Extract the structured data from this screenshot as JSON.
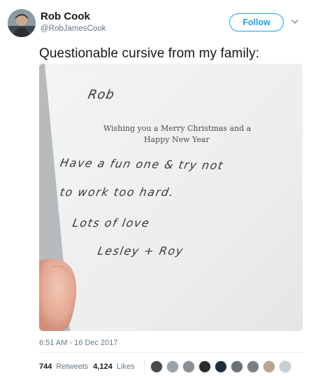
{
  "user": {
    "display_name": "Rob Cook",
    "handle": "@RobJamesCook",
    "follow_label": "Follow"
  },
  "tweet": {
    "text": "Questionable cursive from my family:",
    "timestamp": "6:51 AM - 16 Dec 2017"
  },
  "card": {
    "handwritten_name": "Rob",
    "printed_line1": "Wishing you a Merry Christmas and a",
    "printed_line2": "Happy New Year",
    "handwritten_line1": "Have a fun one & try not",
    "handwritten_line2": "to work too hard.",
    "handwritten_line3": "Lots of love",
    "handwritten_line4": "Lesley + Roy"
  },
  "stats": {
    "retweets_count": "744",
    "retweets_label": "Retweets",
    "likes_count": "4,124",
    "likes_label": "Likes",
    "liker_colors": [
      "#4a4a4a",
      "#9ca3a8",
      "#8a8f93",
      "#2b2b2b",
      "#1f2d3d",
      "#6b6f73",
      "#7a7f83",
      "#b9a48a",
      "#c8cdd1"
    ]
  },
  "icons": {
    "caret": "chevron-down-icon",
    "avatar": "avatar"
  }
}
